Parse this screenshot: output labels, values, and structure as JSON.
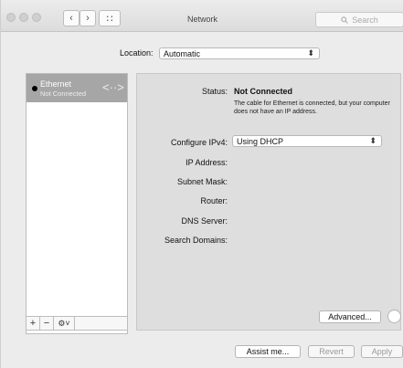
{
  "window": {
    "title": "Network",
    "search_placeholder": "Search",
    "back_glyph": "‹",
    "forward_glyph": "›",
    "grid_glyph": "∷"
  },
  "location": {
    "label": "Location:",
    "value": "Automatic"
  },
  "sidebar": {
    "items": [
      {
        "name": "Ethernet",
        "status": "Not Connected",
        "icon": "ethernet-icon"
      }
    ],
    "footer": {
      "add": "+",
      "remove": "−",
      "action": "⚙˅"
    }
  },
  "detail": {
    "status_label": "Status:",
    "status_value": "Not Connected",
    "status_note": "The cable for Ethernet is connected, but your computer does not have an IP address.",
    "configure_label": "Configure IPv4:",
    "configure_value": "Using DHCP",
    "ip_label": "IP Address:",
    "subnet_label": "Subnet Mask:",
    "router_label": "Router:",
    "dns_label": "DNS Server:",
    "search_domains_label": "Search Domains:",
    "advanced_button": "Advanced...",
    "popup_arrows": "⬍"
  },
  "footer": {
    "assist": "Assist me...",
    "revert": "Revert",
    "apply": "Apply"
  },
  "colors": {
    "selection": "#a6a6a6",
    "window_bg": "#ececec"
  }
}
